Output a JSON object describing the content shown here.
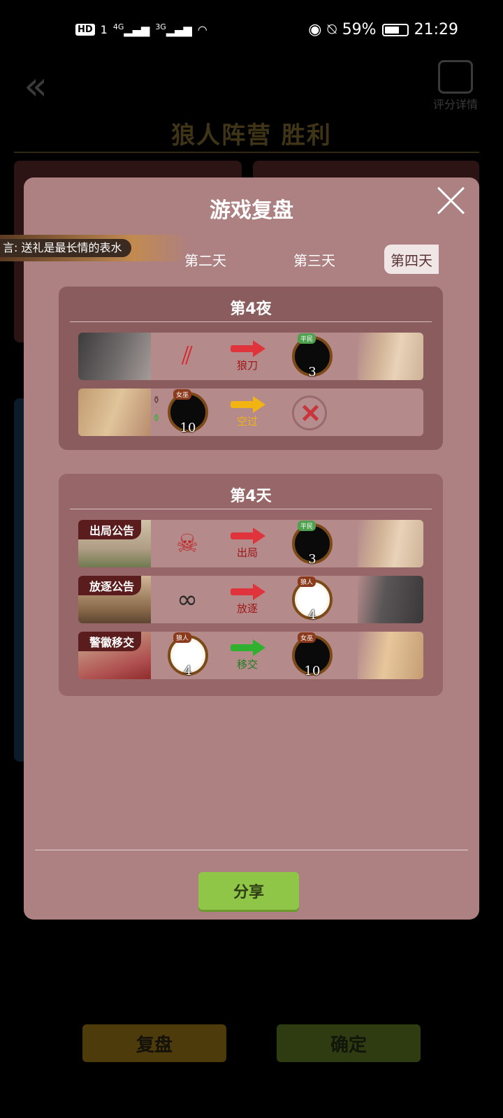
{
  "status_bar": {
    "hd": "HD",
    "sim": "1",
    "net1": "4G",
    "net2": "3G",
    "battery": "59%",
    "time": "21:29"
  },
  "background": {
    "back_icon": "«",
    "detail_label": "评分详情",
    "title": "狼人阵营  胜利",
    "replay_button": "复盘",
    "confirm_button": "确定"
  },
  "banner": {
    "text": "言:  送礼是最长情的表水"
  },
  "modal": {
    "title": "游戏复盘",
    "tabs": [
      "第二天",
      "第三天",
      "第四天"
    ],
    "active_tab": 2,
    "night": {
      "title": "第4夜",
      "rows": [
        {
          "arrow_text": "狼刀",
          "target_tag": "平民",
          "target_num": "3"
        },
        {
          "actor_tag": "女巫",
          "actor_num": "10",
          "arrow_text": "空过"
        }
      ]
    },
    "day": {
      "title": "第4天",
      "rows": [
        {
          "label": "出局公告",
          "arrow_text": "出局",
          "target_tag": "平民",
          "target_num": "3"
        },
        {
          "label": "放逐公告",
          "arrow_text": "放逐",
          "target_tag": "狼人",
          "target_num": "4"
        },
        {
          "label": "警徽移交",
          "from_tag": "狼人",
          "from_num": "4",
          "arrow_text": "移交",
          "target_tag": "女巫",
          "target_num": "10"
        }
      ]
    },
    "share_button": "分享"
  }
}
